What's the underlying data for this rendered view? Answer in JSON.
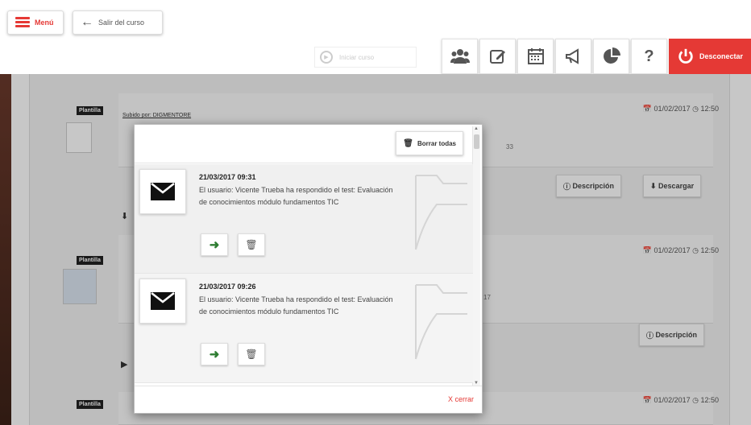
{
  "header": {
    "menu_label": "Menú",
    "exit_label": "Salir del curso",
    "init_course_label": "Iniciar curso",
    "disconnect_label": "Desconectar",
    "tools": [
      {
        "icon": "users-icon"
      },
      {
        "icon": "edit-icon"
      },
      {
        "icon": "calendar-icon"
      },
      {
        "icon": "megaphone-icon"
      },
      {
        "icon": "pie-chart-icon"
      },
      {
        "icon": "help-icon",
        "glyph": "?"
      }
    ]
  },
  "background": {
    "rows": [
      {
        "tag": "Plantilla",
        "uploaded_by": "Subido por: DIGMENTORE",
        "date": "01/02/2017",
        "time": "12:50",
        "trailing_text": "33"
      },
      {
        "tag": "Plantilla",
        "date": "01/02/2017",
        "time": "12:50",
        "trailing_text": "17"
      },
      {
        "tag": "Plantilla",
        "date": "01/02/2017",
        "time": "12:50"
      }
    ],
    "description_label": "Descripción",
    "download_label": "Descargar"
  },
  "modal": {
    "clear_all_label": "Borrar todas",
    "close_label": "X cerrar",
    "notifications": [
      {
        "datetime": "21/03/2017 09:31",
        "message": "El usuario: Vicente Trueba ha respondido el test: Evaluación de conocimientos módulo fundamentos TIC"
      },
      {
        "datetime": "21/03/2017 09:26",
        "message": "El usuario: Vicente Trueba ha respondido el test: Evaluación de conocimientos módulo fundamentos TIC"
      }
    ]
  },
  "colors": {
    "accent": "#e53935",
    "go_green": "#2e7d32"
  }
}
